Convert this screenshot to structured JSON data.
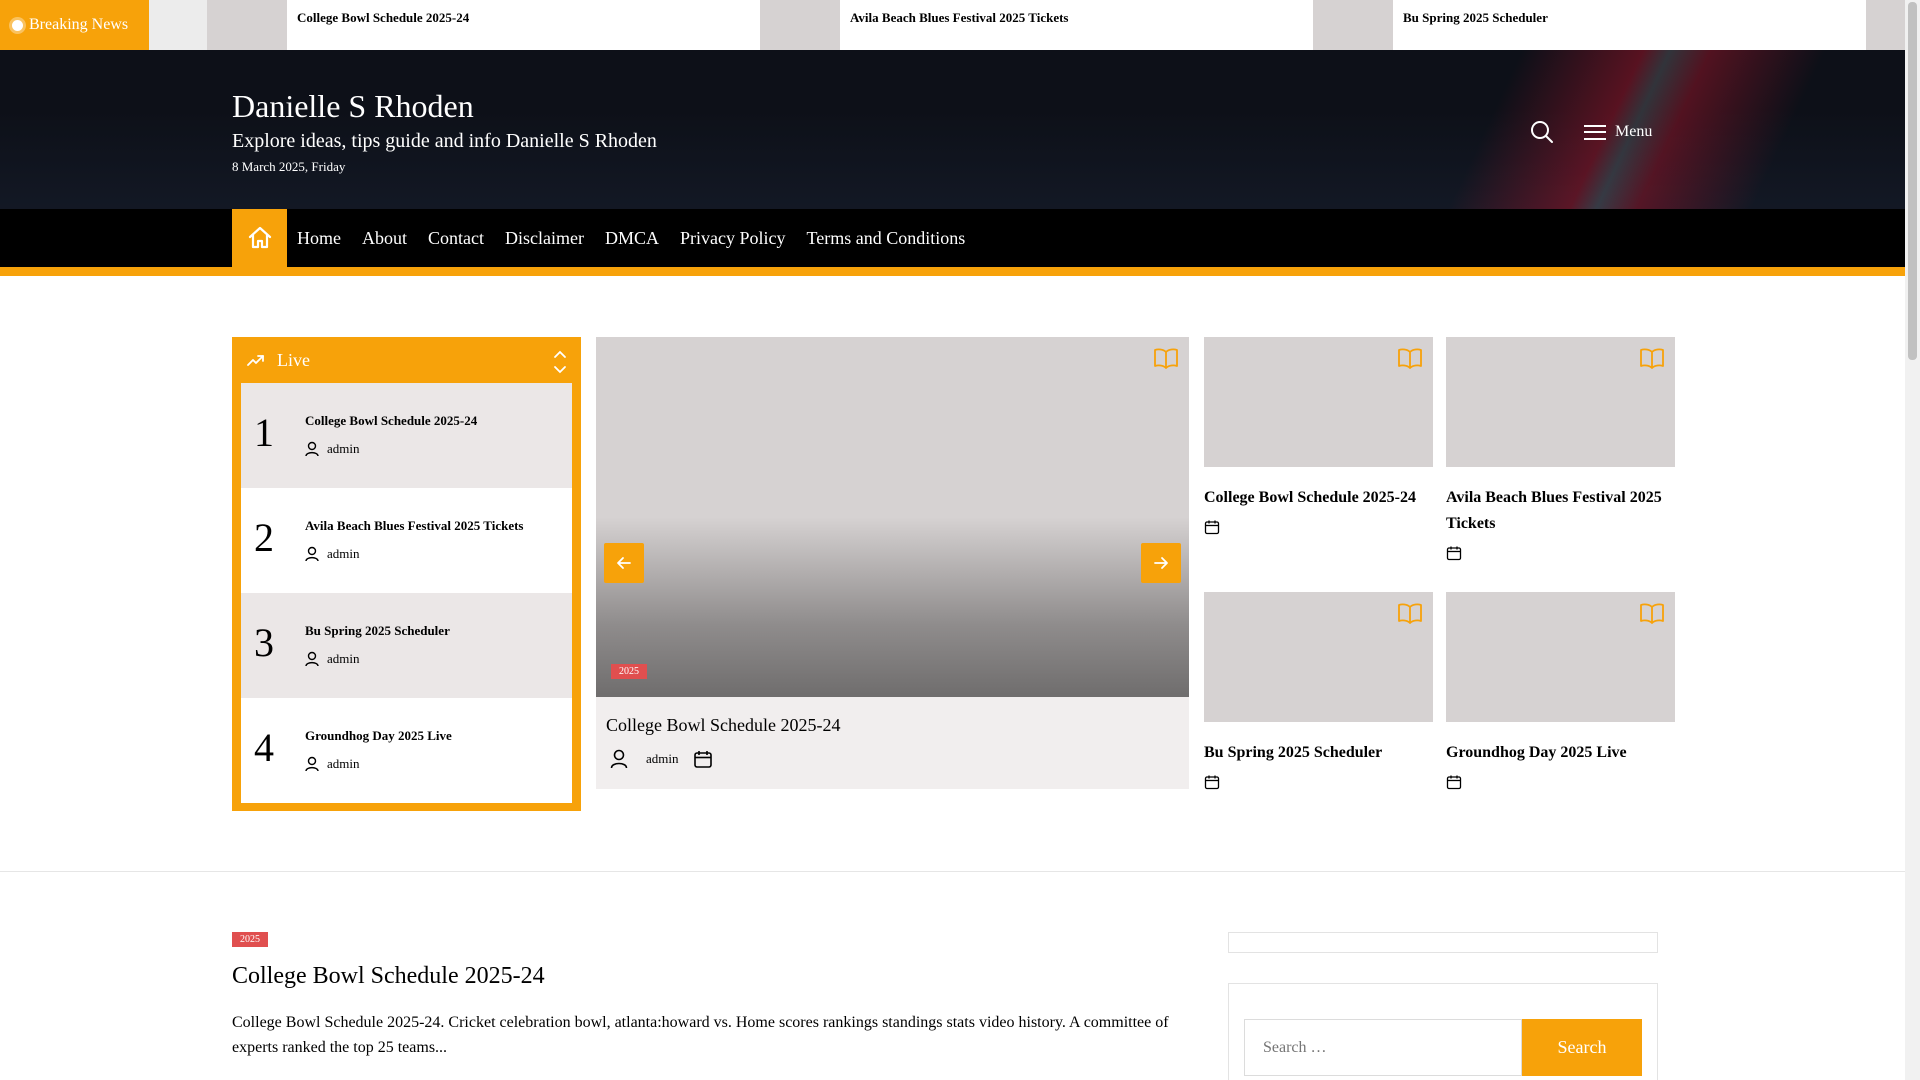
{
  "ticker": {
    "label": "Breaking News",
    "items": [
      {
        "title": "College Bowl Schedule 2025-24"
      },
      {
        "title": "Avila Beach Blues Festival 2025 Tickets"
      },
      {
        "title": "Bu Spring 2025 Scheduler"
      }
    ]
  },
  "header": {
    "site_title": "Danielle S Rhoden",
    "site_description": "Explore ideas, tips guide and info Danielle S Rhoden",
    "date": "8 March 2025, Friday",
    "menu_label": "Menu"
  },
  "nav": {
    "items": [
      "Home",
      "About",
      "Contact",
      "Disclaimer",
      "DMCA",
      "Privacy Policy",
      "Terms and Conditions"
    ]
  },
  "live": {
    "title": "Live",
    "items": [
      {
        "num": "1",
        "title": "College Bowl Schedule 2025-24",
        "author": "admin"
      },
      {
        "num": "2",
        "title": "Avila Beach Blues Festival 2025 Tickets",
        "author": "admin"
      },
      {
        "num": "3",
        "title": "Bu Spring 2025 Scheduler",
        "author": "admin"
      },
      {
        "num": "4",
        "title": "Groundhog Day 2025 Live",
        "author": "admin"
      }
    ]
  },
  "slider": {
    "tag": "2025",
    "title": "College Bowl Schedule 2025-24",
    "author": "admin"
  },
  "grid": [
    {
      "title": "College Bowl Schedule 2025-24"
    },
    {
      "title": "Avila Beach Blues Festival 2025 Tickets"
    },
    {
      "title": "Bu Spring 2025 Scheduler"
    },
    {
      "title": "Groundhog Day 2025 Live"
    }
  ],
  "article": {
    "tag": "2025",
    "title": "College Bowl Schedule 2025-24",
    "excerpt": "College Bowl Schedule 2025-24. Cricket celebration bowl, atlanta:howard vs. Home scores rankings standings stats video history. A committee of experts ranked the top 25 teams..."
  },
  "sidebar": {
    "search_placeholder": "Search …",
    "search_button": "Search"
  },
  "colors": {
    "accent": "#f7a20a",
    "header_bg": "#0d1018",
    "tag_red": "#e04f4f"
  }
}
